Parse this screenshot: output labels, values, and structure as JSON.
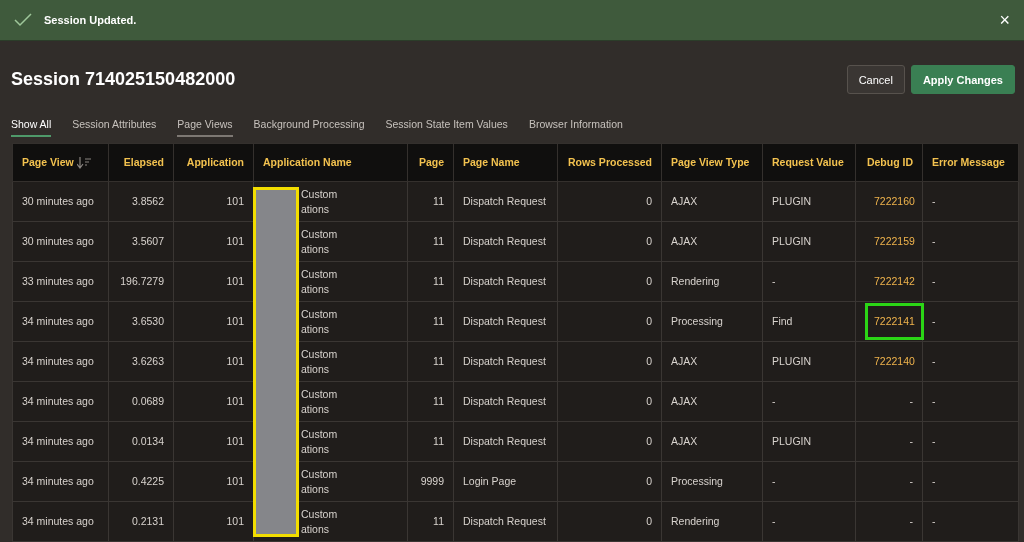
{
  "notification": {
    "message": "Session Updated.",
    "close": "×"
  },
  "title": "Session 714025150482000",
  "buttons": [
    {
      "label": "Cancel",
      "kind": "secondary"
    },
    {
      "label": "Apply Changes",
      "kind": "primary"
    }
  ],
  "tabs": [
    {
      "label": "Show All",
      "selected": true,
      "underlined": false
    },
    {
      "label": "Session Attributes",
      "selected": false,
      "underlined": false
    },
    {
      "label": "Page Views",
      "selected": false,
      "underlined": true
    },
    {
      "label": "Background Processing",
      "selected": false,
      "underlined": false
    },
    {
      "label": "Session State Item Values",
      "selected": false,
      "underlined": false
    },
    {
      "label": "Browser Information",
      "selected": false,
      "underlined": false
    }
  ],
  "table": {
    "columns": [
      {
        "label": "Page View",
        "kind": "text",
        "sorted": true
      },
      {
        "label": "Elapsed",
        "kind": "number",
        "sorted": false
      },
      {
        "label": "Application",
        "kind": "number",
        "sorted": false
      },
      {
        "label": "Application Name",
        "kind": "text",
        "sorted": false
      },
      {
        "label": "Page",
        "kind": "number",
        "sorted": false
      },
      {
        "label": "Page Name",
        "kind": "text",
        "sorted": false
      },
      {
        "label": "Rows Processed",
        "kind": "number",
        "sorted": false
      },
      {
        "label": "Page View Type",
        "kind": "text",
        "sorted": false
      },
      {
        "label": "Request Value",
        "kind": "text",
        "sorted": false
      },
      {
        "label": "Debug ID",
        "kind": "number",
        "sorted": false
      },
      {
        "label": "Error Message",
        "kind": "text",
        "sorted": false
      }
    ],
    "rows": [
      {
        "cells": [
          "30 minutes ago",
          "3.8562",
          "101",
          "Custom ations",
          "11",
          "Dispatch Request",
          "0",
          "AJAX",
          "PLUGIN",
          "7222160",
          "-"
        ],
        "debug_link": true,
        "highlighted": false
      },
      {
        "cells": [
          "30 minutes ago",
          "3.5607",
          "101",
          "Custom ations",
          "11",
          "Dispatch Request",
          "0",
          "AJAX",
          "PLUGIN",
          "7222159",
          "-"
        ],
        "debug_link": true,
        "highlighted": false
      },
      {
        "cells": [
          "33 minutes ago",
          "196.7279",
          "101",
          "Custom ations",
          "11",
          "Dispatch Request",
          "0",
          "Rendering",
          "-",
          "7222142",
          "-"
        ],
        "debug_link": true,
        "highlighted": false
      },
      {
        "cells": [
          "34 minutes ago",
          "3.6530",
          "101",
          "Custom ations",
          "11",
          "Dispatch Request",
          "0",
          "Processing",
          "Find",
          "7222141",
          "-"
        ],
        "debug_link": true,
        "highlighted": true
      },
      {
        "cells": [
          "34 minutes ago",
          "3.6263",
          "101",
          "Custom ations",
          "11",
          "Dispatch Request",
          "0",
          "AJAX",
          "PLUGIN",
          "7222140",
          "-"
        ],
        "debug_link": true,
        "highlighted": false
      },
      {
        "cells": [
          "34 minutes ago",
          "0.0689",
          "101",
          "Custom ations",
          "11",
          "Dispatch Request",
          "0",
          "AJAX",
          "-",
          "-",
          "-"
        ],
        "debug_link": false,
        "highlighted": false
      },
      {
        "cells": [
          "34 minutes ago",
          "0.0134",
          "101",
          "Custom ations",
          "11",
          "Dispatch Request",
          "0",
          "AJAX",
          "PLUGIN",
          "-",
          "-"
        ],
        "debug_link": false,
        "highlighted": false
      },
      {
        "cells": [
          "34 minutes ago",
          "0.4225",
          "101",
          "Custom ations",
          "9999",
          "Login Page",
          "0",
          "Processing",
          "-",
          "-",
          "-"
        ],
        "debug_link": false,
        "highlighted": false
      },
      {
        "cells": [
          "34 minutes ago",
          "0.2131",
          "101",
          "Custom ations",
          "11",
          "Dispatch Request",
          "0",
          "Rendering",
          "-",
          "-",
          "-"
        ],
        "debug_link": false,
        "highlighted": false
      }
    ]
  }
}
